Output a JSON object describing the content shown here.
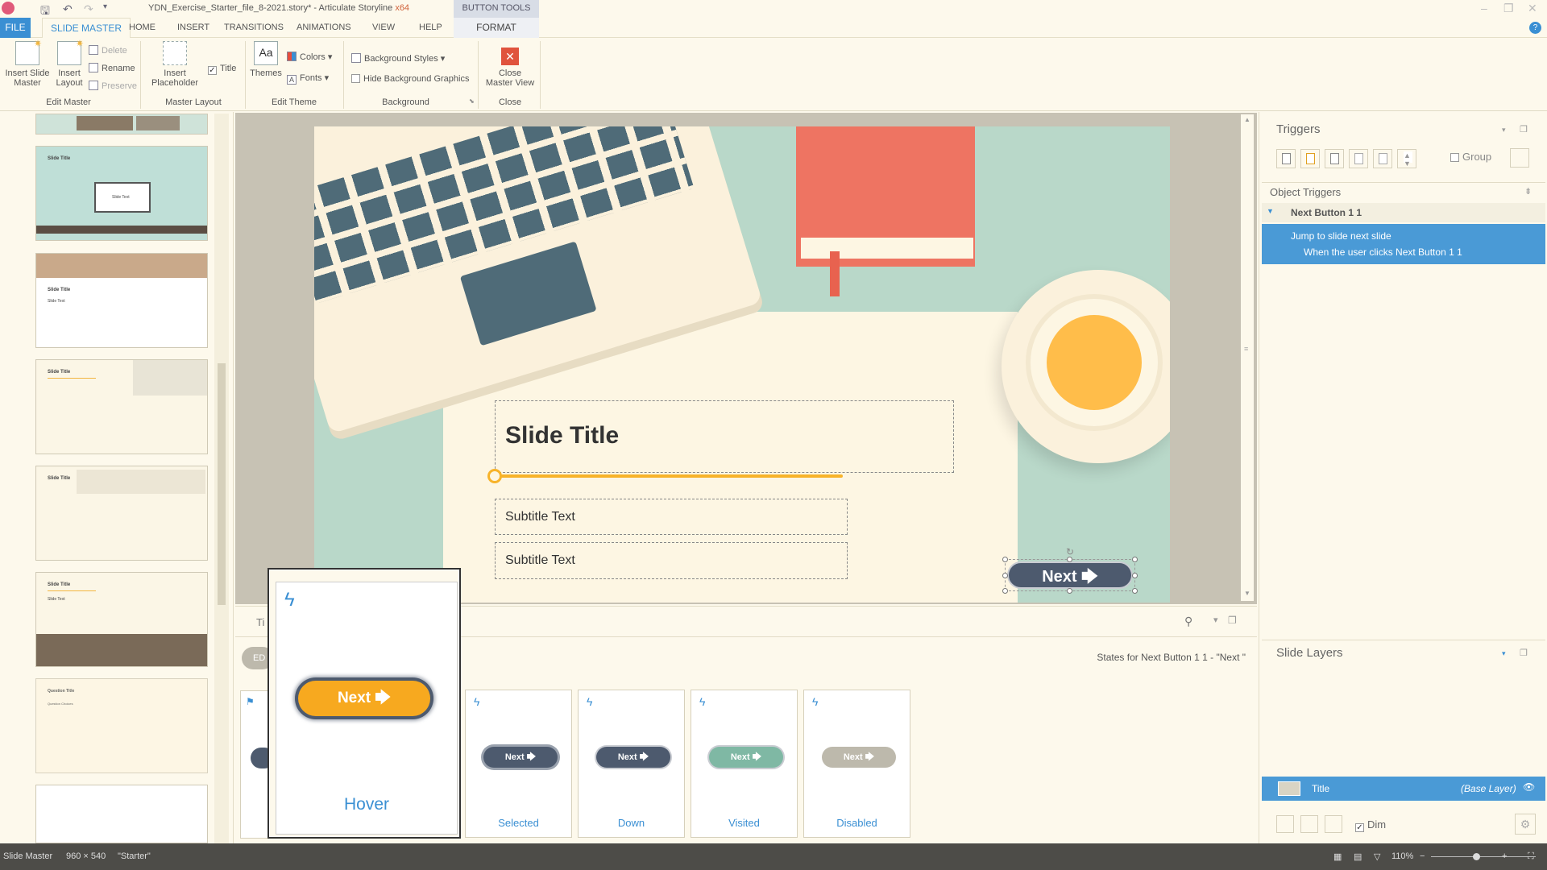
{
  "window": {
    "title": "YDN_Exercise_Starter_file_8-2021.story* - Articulate Storyline",
    "arch": "x64",
    "contextual_tab_group": "BUTTON TOOLS"
  },
  "tabs": [
    "FILE",
    "SLIDE MASTER",
    "HOME",
    "INSERT",
    "TRANSITIONS",
    "ANIMATIONS",
    "VIEW",
    "HELP",
    "FORMAT"
  ],
  "ribbon": {
    "insert_slide_master": "Insert Slide\nMaster",
    "insert_layout": "Insert\nLayout",
    "delete": "Delete",
    "rename": "Rename",
    "preserve": "Preserve",
    "group_edit_master": "Edit Master",
    "insert_placeholder": "Insert\nPlaceholder",
    "title_checkbox": "Title",
    "group_master_layout": "Master Layout",
    "themes": "Themes",
    "themes_icon_text": "Aa",
    "colors": "Colors",
    "fonts": "Fonts",
    "group_edit_theme": "Edit Theme",
    "background_styles": "Background Styles",
    "hide_background_graphics": "Hide Background Graphics",
    "group_background": "Background",
    "close_master_view": "Close\nMaster View",
    "group_close": "Close"
  },
  "thumbnails": [
    {
      "title": "Slide Title",
      "subtitle": "Slide Text"
    },
    {
      "title": "Slide Title",
      "subtitle": "Slide Text"
    },
    {
      "title": "Slide Title",
      "subtitle": ""
    },
    {
      "title": "Slide Title",
      "subtitle": ""
    },
    {
      "title": "Slide Title",
      "subtitle": "Slide Text"
    },
    {
      "title": "Question Title",
      "subtitle": "Question Choices"
    }
  ],
  "slide": {
    "title": "Slide Title",
    "subtitle_1": "Subtitle Text",
    "subtitle_2": "Subtitle Text",
    "next_button": "Next",
    "arrow": "🡆"
  },
  "states_panel": {
    "tab_partial": "Ti",
    "edit_partial": "ED",
    "states_caption": "States for Next Button 1 1 - \"Next \"",
    "states": [
      {
        "label": "Hover",
        "button": "Next",
        "color": "#f7a91f"
      },
      {
        "label": "Selected",
        "button": "Next",
        "color": "#4d5a6e"
      },
      {
        "label": "Down",
        "button": "Next",
        "color": "#4d5a6e"
      },
      {
        "label": "Visited",
        "button": "Next",
        "color": "#7fb8a4"
      },
      {
        "label": "Disabled",
        "button": "Next",
        "color": "#bdb9ac"
      }
    ]
  },
  "triggers": {
    "panel_title": "Triggers",
    "group_label": "Group",
    "object_triggers": "Object Triggers",
    "object_name": "Next Button 1 1",
    "action": "Jump to slide next slide",
    "condition": "When the user clicks Next Button 1 1"
  },
  "layers": {
    "panel_title": "Slide Layers",
    "base_layer_name": "Title",
    "base_layer_tag": "(Base Layer)",
    "dim_label": "Dim"
  },
  "statusbar": {
    "mode": "Slide Master",
    "size": "960 × 540",
    "theme": "\"Starter\"",
    "zoom": "110%"
  },
  "colors": {
    "accent": "#3a8fd3",
    "selection": "#4a9ad6",
    "slide_bg": "#fdf6e3",
    "mint": "#b9d8c9",
    "book": "#ee7462",
    "keyboard": "#4f6b78",
    "coffee": "#ffbd4a",
    "next_button": "#4d5a6e",
    "progress": "#f7b32a"
  }
}
